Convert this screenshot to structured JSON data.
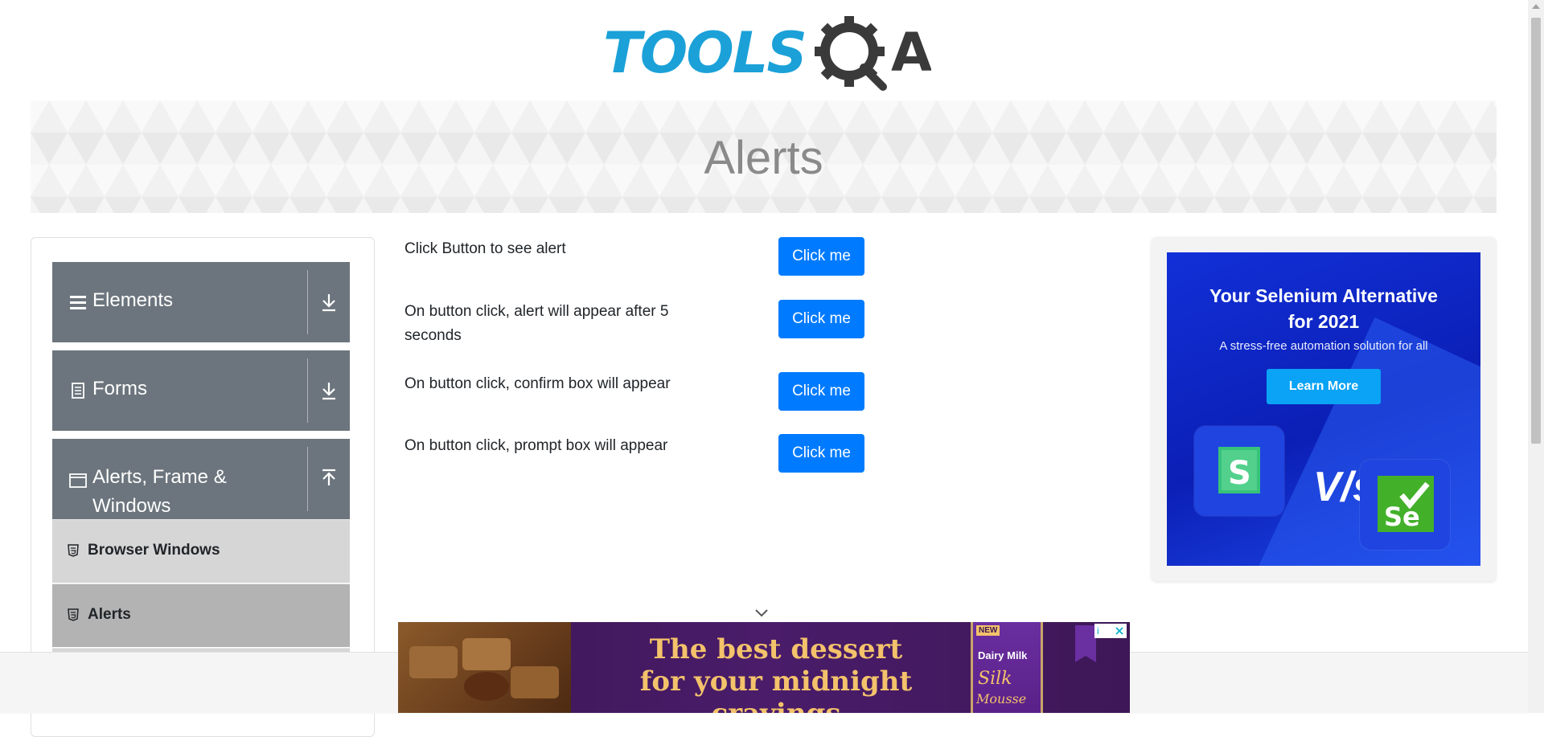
{
  "header": {
    "logo_text": "TOOLS",
    "logo_mark": "QA"
  },
  "banner": {
    "title": "Alerts"
  },
  "sidebar": {
    "groups": [
      {
        "label": "Elements",
        "icon": "hamburger-icon",
        "arrow": "download-arrow-icon"
      },
      {
        "label": "Forms",
        "icon": "document-icon",
        "arrow": "download-arrow-icon"
      },
      {
        "label": "Alerts, Frame & Windows",
        "icon": "window-icon",
        "arrow": "upload-arrow-icon"
      }
    ],
    "sub_items": [
      {
        "label": "Browser Windows",
        "icon": "html5-icon",
        "active": false
      },
      {
        "label": "Alerts",
        "icon": "html5-icon",
        "active": true
      }
    ]
  },
  "main": {
    "rows": [
      {
        "label": "Click Button to see alert",
        "button": "Click me"
      },
      {
        "label": "On button click, alert will appear after 5 seconds",
        "button": "Click me"
      },
      {
        "label": "On button click, confirm box will appear",
        "button": "Click me"
      },
      {
        "label": "On button click, prompt box will appear",
        "button": "Click me"
      }
    ]
  },
  "side_ad": {
    "headline_1": "Your Selenium Alternative",
    "headline_2": "for 2021",
    "subtitle": "A stress-free automation solution for all",
    "cta": "Learn More",
    "vs": "V/s",
    "left_logo": "S",
    "right_logo": "Se"
  },
  "bottom_ad": {
    "line1": "The best dessert",
    "line2": "for your midnight cravings",
    "pack_brand": "Dairy Milk",
    "pack_name": "Silk",
    "pack_variant": "Mousse",
    "pack_badge": "NEW",
    "ad_choice": "i"
  },
  "colors": {
    "primary_button": "#007bff",
    "sidebar_group": "#6c757d",
    "logo_blue": "#1ba1d8",
    "logo_dark": "#3a3a3a"
  }
}
